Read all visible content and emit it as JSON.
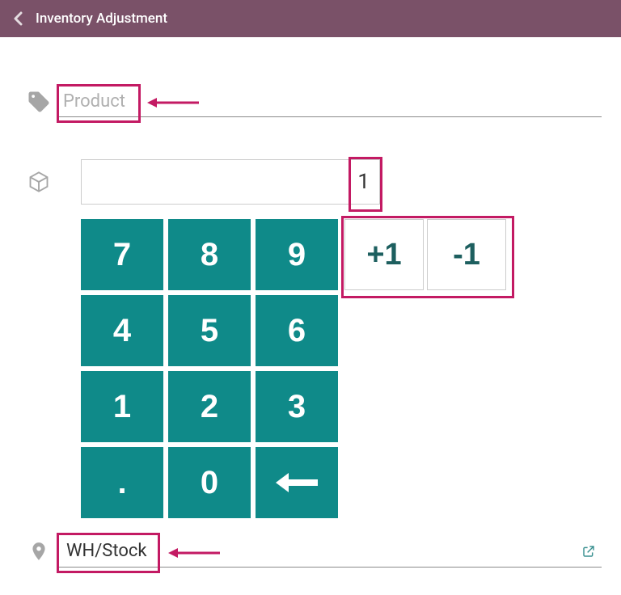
{
  "header": {
    "title": "Inventory Adjustment"
  },
  "product": {
    "placeholder": "Product"
  },
  "quantity": {
    "value": "1"
  },
  "keypad": {
    "k7": "7",
    "k8": "8",
    "k9": "9",
    "k4": "4",
    "k5": "5",
    "k6": "6",
    "k1": "1",
    "k2": "2",
    "k3": "3",
    "dot": ".",
    "k0": "0"
  },
  "adjust": {
    "plus": "+1",
    "minus": "-1"
  },
  "location": {
    "value": "WH/Stock"
  }
}
